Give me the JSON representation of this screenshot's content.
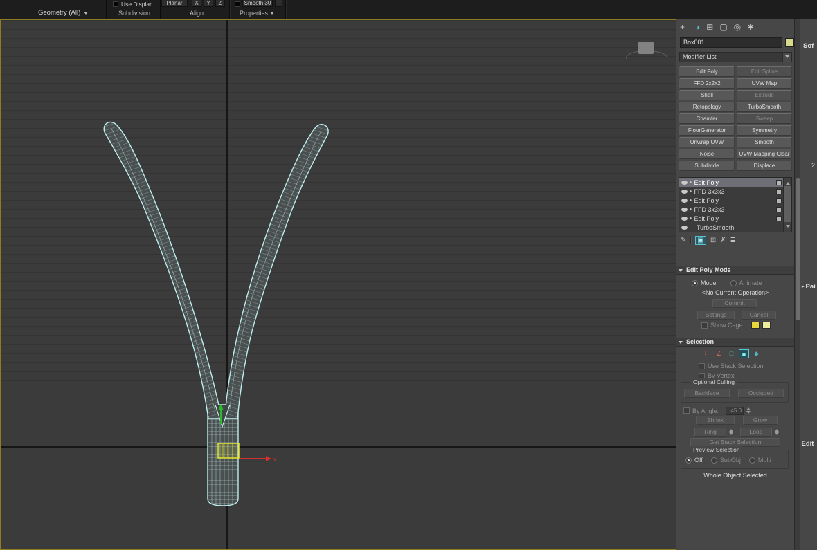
{
  "colors": {
    "viewport_border": "#8f7d22",
    "wireframe": "#bfeeee",
    "selection_teal": "#4fb8c4",
    "object_swatch": "#d8d98a",
    "gizmo_yellow": "#e6e632",
    "axis_x_red": "#d03030",
    "axis_y_green": "#2eb82e"
  },
  "icons": {
    "dropdown": "▾",
    "expand": "▸",
    "plus": "+",
    "modify_tab": "◑",
    "hierarchy_tab": "⊞",
    "display_tab": "▢",
    "motion_tab": "◎",
    "utilities_tab": "✱",
    "pin_stack": "✎",
    "show_end_result": "▣",
    "make_unique": "⊡",
    "remove_modifier": "✗",
    "configure_sets": "≣",
    "vertex": "∷",
    "edge": "∠",
    "border": "□",
    "polygon": "■",
    "element": "◆"
  },
  "ribbon": {
    "geometry_dropdown": "Geometry (All)",
    "use_displace": "Use Displac...",
    "planar": "Planar",
    "axis_x": "X",
    "axis_y": "Y",
    "axis_z": "Z",
    "smooth": "Smooth 30",
    "group_subdivision": "Subdivision",
    "group_align": "Align",
    "group_properties": "Properties"
  },
  "viewport": {
    "x_axis_label": "x"
  },
  "panel": {
    "object_name": "Box001",
    "modifier_list": "Modifier List",
    "modifier_buttons": [
      {
        "label": "Edit Poly",
        "enabled": true
      },
      {
        "label": "Edit Spline",
        "enabled": false
      },
      {
        "label": "FFD 2x2x2",
        "enabled": true
      },
      {
        "label": "UVW Map",
        "enabled": true
      },
      {
        "label": "Shell",
        "enabled": true
      },
      {
        "label": "Extrude",
        "enabled": false
      },
      {
        "label": "Retopology",
        "enabled": true
      },
      {
        "label": "TurboSmooth",
        "enabled": true
      },
      {
        "label": "Chamfer",
        "enabled": true
      },
      {
        "label": "Sweep",
        "enabled": false
      },
      {
        "label": "FloorGenerator",
        "enabled": true
      },
      {
        "label": "Symmetry",
        "enabled": true
      },
      {
        "label": "Unwrap UVW",
        "enabled": true
      },
      {
        "label": "Smooth",
        "enabled": true
      },
      {
        "label": "Noise",
        "enabled": true
      },
      {
        "label": "UVW Mapping Clear",
        "enabled": true
      },
      {
        "label": "Subdivide",
        "enabled": true
      },
      {
        "label": "Displace",
        "enabled": true
      }
    ],
    "stack": [
      {
        "name": "Edit Poly",
        "selected": true
      },
      {
        "name": "FFD 3x3x3",
        "selected": false
      },
      {
        "name": "Edit Poly",
        "selected": false
      },
      {
        "name": "FFD 3x3x3",
        "selected": false
      },
      {
        "name": "Edit Poly",
        "selected": false
      },
      {
        "name": "TurboSmooth",
        "selected": false
      }
    ],
    "edit_poly_mode": {
      "title": "Edit Poly Mode",
      "model": "Model",
      "animate": "Animate",
      "operation": "<No Current Operation>",
      "commit": "Commit",
      "settings": "Settings",
      "cancel": "Cancel",
      "show_cage": "Show Cage"
    },
    "selection": {
      "title": "Selection",
      "use_stack_selection": "Use Stack Selection",
      "by_vertex": "By Vertex",
      "optional_culling": "Optional Culling",
      "backface": "Backface",
      "occluded": "Occluded",
      "by_angle": "By Angle:",
      "angle_value": "45.0",
      "shrink": "Shrink",
      "grow": "Grow",
      "ring": "Ring",
      "loop": "Loop",
      "get_stack_selection": "Get Stack Selection",
      "preview_selection": "Preview Selection",
      "off": "Off",
      "subobj": "SubObj",
      "multi": "Multi",
      "whole_object": "Whole Object Selected"
    }
  },
  "right_strip": {
    "soft": "Sof",
    "value2": "2",
    "paint": "Pai",
    "edit": "Edit"
  }
}
